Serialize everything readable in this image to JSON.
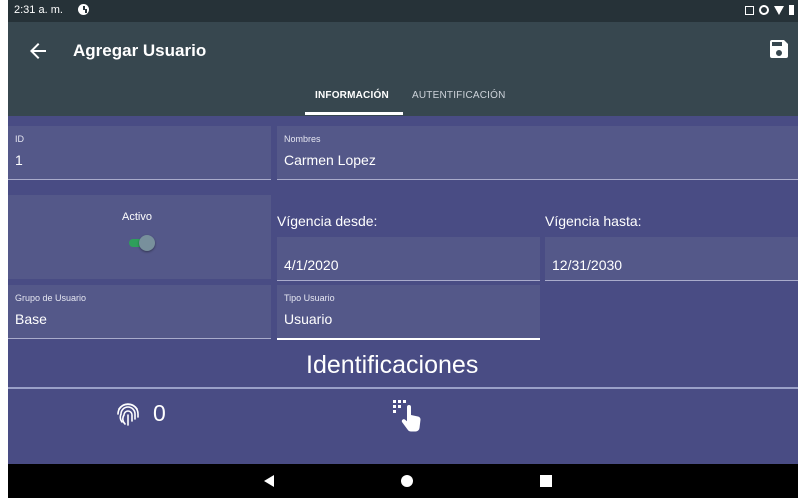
{
  "status_bar": {
    "time": "2:31 a. m."
  },
  "app_bar": {
    "title": "Agregar Usuario",
    "back_icon": "arrow-left-icon",
    "save_icon": "floppy-save-icon"
  },
  "tabs": [
    {
      "label": "INFORMACIÓN",
      "selected": true
    },
    {
      "label": "AUTENTIFICACIÓN",
      "selected": false
    }
  ],
  "form": {
    "id": {
      "label": "ID",
      "value": "1"
    },
    "nombres": {
      "label": "Nombres",
      "value": "Carmen Lopez"
    },
    "activo": {
      "label": "Activo",
      "on": true
    },
    "vigencia_desde": {
      "label": "Vígencia desde:",
      "value": "4/1/2020"
    },
    "vigencia_hasta": {
      "label": "Vígencia hasta:",
      "value": "12/31/2030"
    },
    "grupo_usuario": {
      "label": "Grupo de Usuario",
      "value": "Base"
    },
    "tipo_usuario": {
      "label": "Tipo Usuario",
      "value": "Usuario"
    }
  },
  "identificaciones": {
    "title": "Identificaciones",
    "fingerprint_icon": "fingerprint-icon",
    "fingerprint_count": "0",
    "touch_icon": "keypad-touch-icon"
  },
  "colors": {
    "status_bar": "#263238",
    "app_bar": "#37474f",
    "background": "#494c84",
    "field_bg": "#545889",
    "switch_on": "#2e9f5b"
  }
}
